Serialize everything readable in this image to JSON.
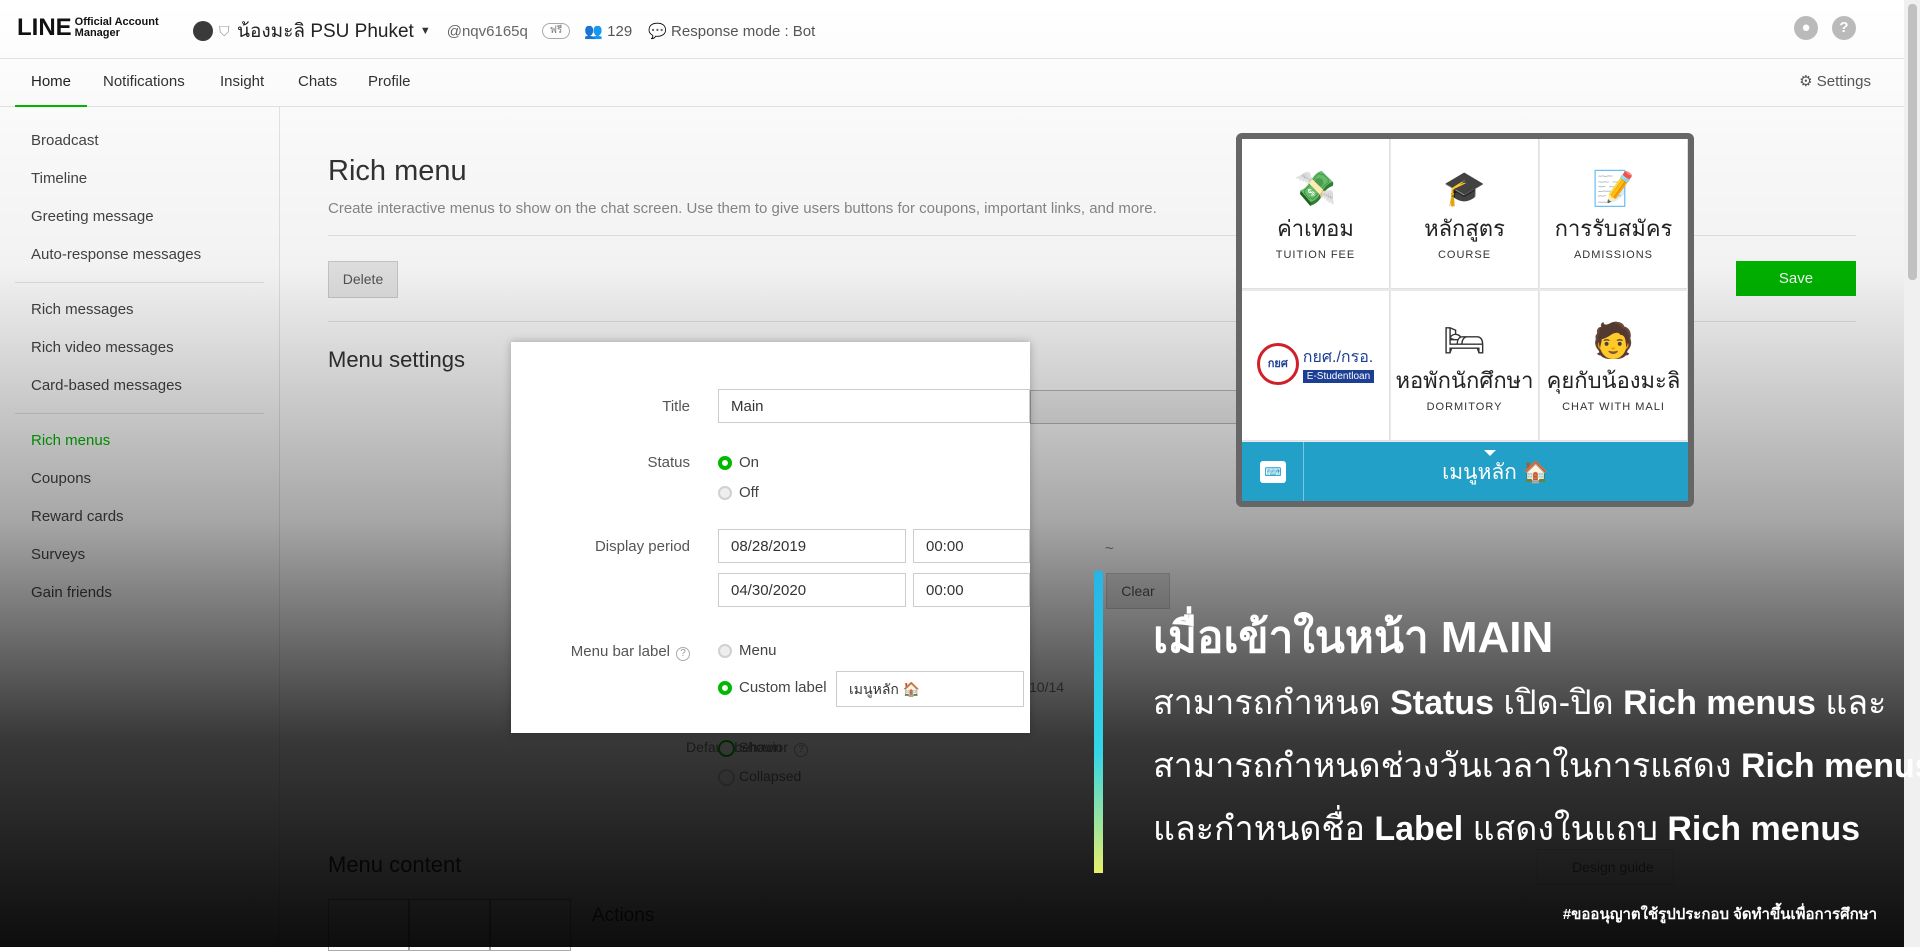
{
  "app": {
    "logo_main": "LINE",
    "logo_sub1": "Official Account",
    "logo_sub2": "Manager",
    "account_name": "น้องมะลิ PSU Phuket",
    "account_id": "@nqv6165q",
    "plan_badge": "ฟรี",
    "friends_count": "129",
    "response_mode": "Response mode : Bot"
  },
  "nav": {
    "tabs": [
      "Home",
      "Notifications",
      "Insight",
      "Chats",
      "Profile"
    ],
    "active_tab": "Home",
    "settings_label": "Settings"
  },
  "sidebar": {
    "items": [
      "Broadcast",
      "Timeline",
      "Greeting message",
      "Auto-response messages",
      "Rich messages",
      "Rich video messages",
      "Card-based messages",
      "Rich menus",
      "Coupons",
      "Reward cards",
      "Surveys",
      "Gain friends"
    ],
    "active_item": "Rich menus"
  },
  "page": {
    "title": "Rich menu",
    "description": "Create interactive menus to show on the chat screen. Use them to give users buttons for coupons, important links, and more.",
    "delete_label": "Delete",
    "save_label": "Save",
    "menu_settings_title": "Menu settings",
    "menu_content_title": "Menu content",
    "design_guide_label": "Design guide",
    "actions_label": "Actions",
    "default_behavior_label": "Default behavior",
    "default_shown": "Shown",
    "default_collapsed": "Collapsed",
    "clear_label": "Clear",
    "char_count": "10/14",
    "range_sep": "~"
  },
  "form": {
    "title_label": "Title",
    "title_value": "Main",
    "status_label": "Status",
    "status_on": "On",
    "status_off": "Off",
    "status_selected": "On",
    "display_period_label": "Display period",
    "start_date": "08/28/2019",
    "start_time": "00:00",
    "end_date": "04/30/2020",
    "end_time": "00:00",
    "menu_bar_label": "Menu bar label",
    "option_menu": "Menu",
    "option_custom": "Custom label",
    "custom_value": "เมนูหลัก 🏠"
  },
  "preview": {
    "cells": [
      {
        "icon": "💸",
        "th": "ค่าเทอม",
        "en": "TUITION FEE"
      },
      {
        "icon": "🎓",
        "th": "หลักสูตร",
        "en": "COURSE"
      },
      {
        "icon": "📝",
        "th": "การรับสมัคร",
        "en": "ADMISSIONS"
      },
      {
        "icon": "",
        "th": "กยศ./กรอ.",
        "en": "E-Studentloan"
      },
      {
        "icon": "🛏",
        "th": "หอพักนักศึกษา",
        "en": "DORMITORY"
      },
      {
        "icon": "🧑",
        "th": "คุยกับน้องมะลิ",
        "en": "CHAT WITH MALI"
      }
    ],
    "menubar_label": "เมนูหลัก 🏠"
  },
  "annotation": {
    "title": "เมื่อเข้าในหน้า MAIN",
    "line1_a": "สามารถกำหนด ",
    "line1_b": "Status",
    "line1_c": " เปิด-ปิด ",
    "line1_d": "Rich menus",
    "line1_e": " และ",
    "line2_a": "สามารถกำหนดช่วงวันเวลาในการแสดง ",
    "line2_b": "Rich menus",
    "line3_a": "และกำหนดชื่อ ",
    "line3_b": "Label",
    "line3_c": " แสดงในแถบ ",
    "line3_d": "Rich menus",
    "footnote": "#ขออนุญาตใช้รูปประกอบ จัดทำขึ้นเพื่อการศึกษา"
  },
  "colors": {
    "accent_green": "#00b900",
    "line_blue": "#22a0c8"
  }
}
